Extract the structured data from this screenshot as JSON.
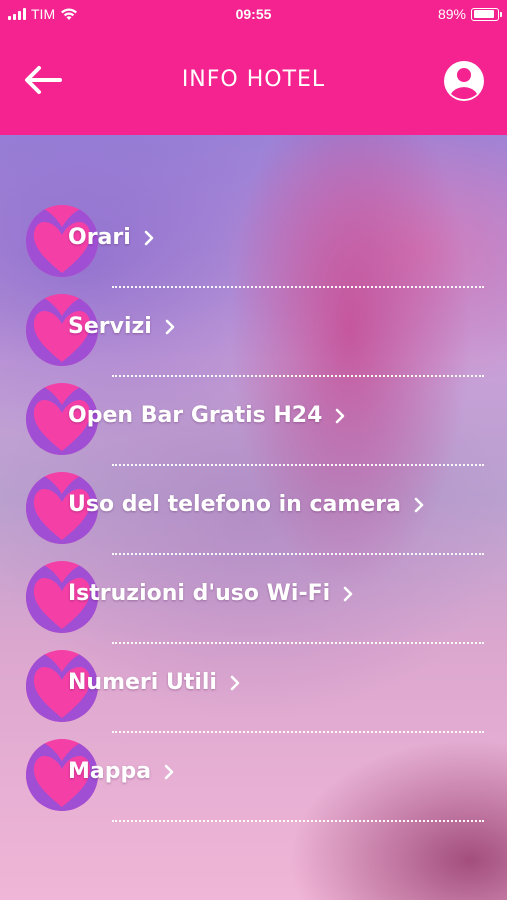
{
  "status_bar": {
    "carrier": "TIM",
    "time": "09:55",
    "battery_percent": "89%",
    "battery_level": 0.89
  },
  "header": {
    "title": "INFO HOTEL",
    "back_icon": "arrow-left-icon",
    "profile_icon": "user-circle-icon"
  },
  "colors": {
    "header_bg": "#f4238f",
    "icon_pink": "#f43fa6",
    "icon_purple": "#9b4fd6"
  },
  "menu": {
    "items": [
      {
        "label": "Orari"
      },
      {
        "label": "Servizi"
      },
      {
        "label": "Open Bar Gratis H24"
      },
      {
        "label": "Uso del telefono in camera"
      },
      {
        "label": "Istruzioni d'uso Wi-Fi"
      },
      {
        "label": "Numeri Utili"
      },
      {
        "label": "Mappa"
      }
    ]
  }
}
